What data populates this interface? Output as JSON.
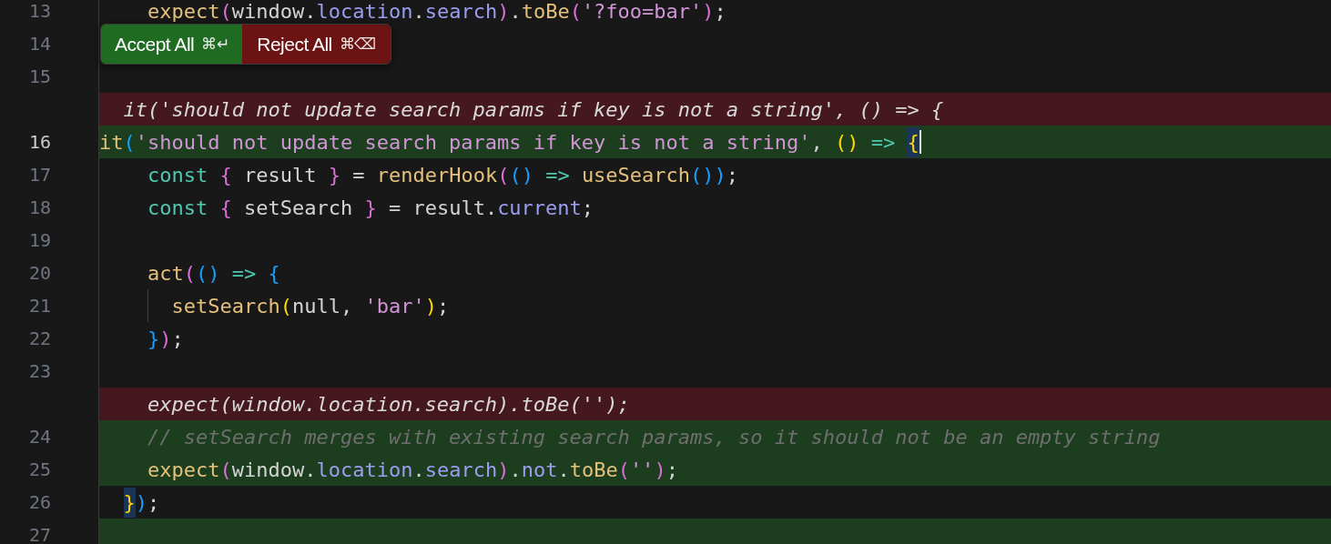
{
  "toolbar": {
    "accept": {
      "label": "Accept All",
      "shortcut": "⌘↵"
    },
    "reject": {
      "label": "Reject All",
      "shortcut": "⌘⌫"
    }
  },
  "lines": [
    {
      "number": "13",
      "kind": "normal",
      "current": false,
      "cursor": false,
      "tokens": [
        {
          "text": "    expect",
          "kind": "fn"
        },
        {
          "text": "(",
          "kind": "br2"
        },
        {
          "text": "window.",
          "kind": "plain"
        },
        {
          "text": "location",
          "kind": "prop"
        },
        {
          "text": ".",
          "kind": "plain"
        },
        {
          "text": "search",
          "kind": "prop"
        },
        {
          "text": ")",
          "kind": "br2"
        },
        {
          "text": ".",
          "kind": "plain"
        },
        {
          "text": "toBe",
          "kind": "fn"
        },
        {
          "text": "(",
          "kind": "br2"
        },
        {
          "text": "'?foo=bar'",
          "kind": "str"
        },
        {
          "text": ")",
          "kind": "br2"
        },
        {
          "text": ";",
          "kind": "plain"
        }
      ]
    },
    {
      "number": "14",
      "kind": "normal",
      "current": false,
      "cursor": false
    },
    {
      "number": "15",
      "kind": "normal",
      "current": false,
      "cursor": false
    },
    {
      "kind": "deleted",
      "text": "  it('should not update search params if key is not a string', () => {"
    },
    {
      "number": "16",
      "kind": "added",
      "current": true,
      "cursor": true,
      "tokens": [
        {
          "text": "it",
          "kind": "fn"
        },
        {
          "text": "(",
          "kind": "br3"
        },
        {
          "text": "'should not update search params if key is not a string'",
          "kind": "str"
        },
        {
          "text": ", ",
          "kind": "plain"
        },
        {
          "text": "()",
          "kind": "br1"
        },
        {
          "text": " => ",
          "kind": "op"
        },
        {
          "text": "{",
          "kind": "match"
        }
      ]
    },
    {
      "number": "17",
      "kind": "normal",
      "current": false,
      "cursor": false,
      "tokens": [
        {
          "text": "    const ",
          "kind": "kw"
        },
        {
          "text": "{",
          "kind": "br2"
        },
        {
          "text": " result ",
          "kind": "plain"
        },
        {
          "text": "}",
          "kind": "br2"
        },
        {
          "text": " = ",
          "kind": "plain"
        },
        {
          "text": "renderHook",
          "kind": "fn"
        },
        {
          "text": "(",
          "kind": "br2"
        },
        {
          "text": "()",
          "kind": "br3"
        },
        {
          "text": " => ",
          "kind": "op"
        },
        {
          "text": "useSearch",
          "kind": "fn"
        },
        {
          "text": "())",
          "kind": "br3"
        },
        {
          "text": ";",
          "kind": "plain"
        }
      ]
    },
    {
      "number": "18",
      "kind": "normal",
      "current": false,
      "cursor": false,
      "tokens": [
        {
          "text": "    const ",
          "kind": "kw"
        },
        {
          "text": "{",
          "kind": "br2"
        },
        {
          "text": " setSearch ",
          "kind": "plain"
        },
        {
          "text": "}",
          "kind": "br2"
        },
        {
          "text": " = result.",
          "kind": "plain"
        },
        {
          "text": "current",
          "kind": "prop"
        },
        {
          "text": ";",
          "kind": "plain"
        }
      ]
    },
    {
      "number": "19",
      "kind": "normal",
      "current": false,
      "cursor": false
    },
    {
      "number": "20",
      "kind": "normal",
      "current": false,
      "cursor": false,
      "tokens": [
        {
          "text": "    act",
          "kind": "fn"
        },
        {
          "text": "(",
          "kind": "br2"
        },
        {
          "text": "()",
          "kind": "br3"
        },
        {
          "text": " => ",
          "kind": "op"
        },
        {
          "text": "{",
          "kind": "br3"
        }
      ]
    },
    {
      "number": "21",
      "kind": "normal",
      "current": false,
      "cursor": false,
      "tokens": [
        {
          "text": "      setSearch",
          "kind": "fn"
        },
        {
          "text": "(",
          "kind": "br1"
        },
        {
          "text": "null, ",
          "kind": "plain"
        },
        {
          "text": "'bar'",
          "kind": "str"
        },
        {
          "text": ")",
          "kind": "br1"
        },
        {
          "text": ";",
          "kind": "plain"
        }
      ]
    },
    {
      "number": "22",
      "kind": "normal",
      "current": false,
      "cursor": false,
      "tokens": [
        {
          "text": "    }",
          "kind": "br3"
        },
        {
          "text": ")",
          "kind": "br2"
        },
        {
          "text": ";",
          "kind": "plain"
        }
      ]
    },
    {
      "number": "23",
      "kind": "normal",
      "current": false,
      "cursor": false
    },
    {
      "kind": "deleted",
      "text": "    expect(window.location.search).toBe('');"
    },
    {
      "number": "24",
      "kind": "added",
      "current": false,
      "cursor": false,
      "tokens": [
        {
          "text": "    // setSearch merges with existing search params, so it should not be an empty string",
          "kind": "comment"
        }
      ]
    },
    {
      "number": "25",
      "kind": "added",
      "current": false,
      "cursor": false,
      "tokens": [
        {
          "text": "    expect",
          "kind": "fn"
        },
        {
          "text": "(",
          "kind": "br2"
        },
        {
          "text": "window.",
          "kind": "plain"
        },
        {
          "text": "location",
          "kind": "prop"
        },
        {
          "text": ".",
          "kind": "plain"
        },
        {
          "text": "search",
          "kind": "prop"
        },
        {
          "text": ")",
          "kind": "br2"
        },
        {
          "text": ".",
          "kind": "plain"
        },
        {
          "text": "not",
          "kind": "prop"
        },
        {
          "text": ".",
          "kind": "plain"
        },
        {
          "text": "toBe",
          "kind": "fn"
        },
        {
          "text": "(",
          "kind": "br2"
        },
        {
          "text": "''",
          "kind": "str"
        },
        {
          "text": ")",
          "kind": "br2"
        },
        {
          "text": ";",
          "kind": "plain"
        }
      ]
    },
    {
      "number": "26",
      "kind": "normal",
      "current": false,
      "cursor": false,
      "tokens": [
        {
          "text": "  }",
          "kind": "match"
        },
        {
          "text": ")",
          "kind": "br3"
        },
        {
          "text": ";",
          "kind": "plain"
        }
      ]
    },
    {
      "number": "27",
      "kind": "added",
      "current": false,
      "cursor": false
    }
  ]
}
